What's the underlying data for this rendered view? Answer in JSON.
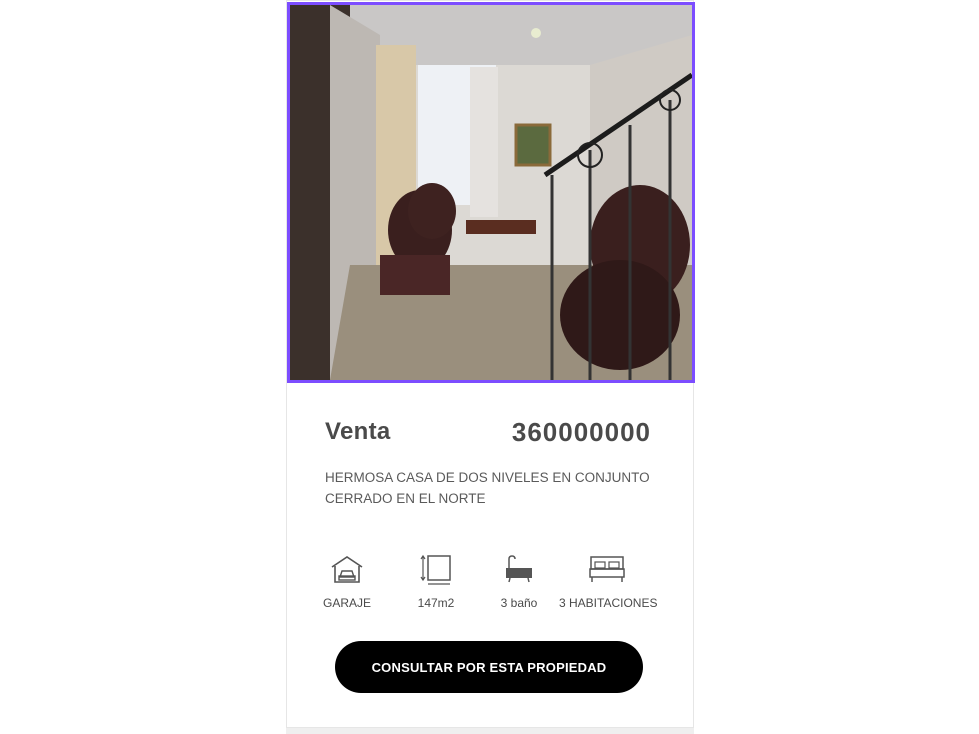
{
  "listing": {
    "operation": "Venta",
    "price": "360000000",
    "description": "HERMOSA CASA DE DOS NIVELES EN CONJUNTO CERRADO EN EL NORTE",
    "features": [
      {
        "icon": "garage-icon",
        "label": "GARAJE"
      },
      {
        "icon": "area-icon",
        "label": "147m2"
      },
      {
        "icon": "bathtub-icon",
        "label": "3 baño"
      },
      {
        "icon": "bed-icon",
        "label": "3 HABITACIONES"
      }
    ],
    "cta_label": "CONSULTAR POR ESTA PROPIEDAD"
  },
  "colors": {
    "photo_border": "#7c4dff",
    "cta_bg": "#000000",
    "text": "#4a4a4a"
  }
}
